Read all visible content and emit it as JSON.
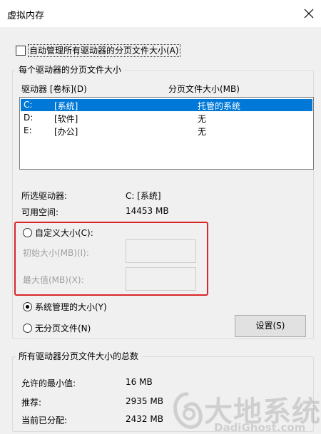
{
  "window": {
    "title": "虚拟内存",
    "close_icon": "close-icon"
  },
  "auto_manage": {
    "label": "自动管理所有驱动器的分页文件大小(A)",
    "checked": false
  },
  "per_drive": {
    "caption": "每个驱动器的分页文件大小",
    "col_drive": "驱动器 [卷标](D)",
    "col_size": "分页文件大小(MB)",
    "rows": [
      {
        "drive": "C:",
        "label": "[系统]",
        "size": "托管的系统",
        "selected": true
      },
      {
        "drive": "D:",
        "label": "[软件]",
        "size": "无",
        "selected": false
      },
      {
        "drive": "E:",
        "label": "[办公]",
        "size": "无",
        "selected": false
      }
    ],
    "selected_drive_label": "所选驱动器:",
    "selected_drive_value": "C:  [系统]",
    "free_space_label": "可用空间:",
    "free_space_value": "14453 MB",
    "custom_size_label": "自定义大小(C):",
    "initial_size_label": "初始大小(MB)(I):",
    "initial_size_value": "",
    "max_size_label": "最大值(MB)(X):",
    "max_size_value": "",
    "system_managed_label": "系统管理的大小(Y)",
    "no_paging_label": "无分页文件(N)",
    "selected_option": "system_managed",
    "set_button": "设置(S)"
  },
  "totals": {
    "caption": "所有驱动器分页文件大小的总数",
    "min_label": "允许的最小值:",
    "min_value": "16 MB",
    "recommended_label": "推荐:",
    "recommended_value": "2935 MB",
    "allocated_label": "当前已分配:",
    "allocated_value": "2432 MB"
  },
  "watermark": {
    "cn": "大地系统",
    "en": "DadiGhost.com"
  },
  "colors": {
    "selection": "#0078d7",
    "highlight_box": "#d9262b"
  }
}
